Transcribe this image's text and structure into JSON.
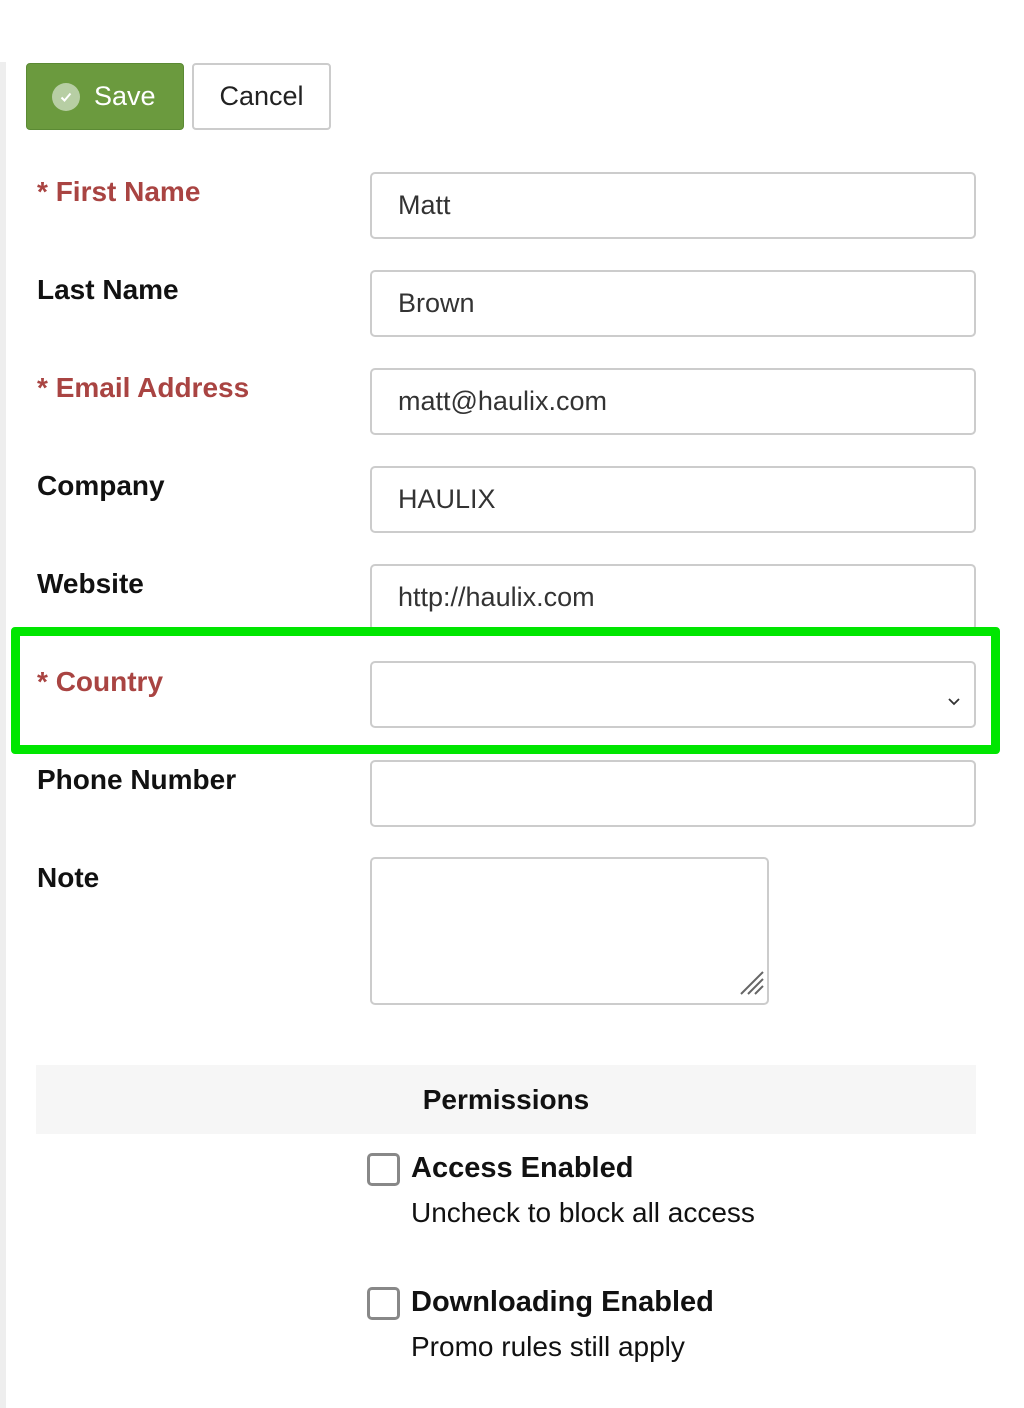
{
  "toolbar": {
    "save_label": "Save",
    "cancel_label": "Cancel",
    "save_icon": "check-circle-icon"
  },
  "form": {
    "first_name": {
      "asterisk": "*",
      "label": "First Name",
      "value": "Matt",
      "required": true
    },
    "last_name": {
      "label": "Last Name",
      "value": "Brown"
    },
    "email": {
      "asterisk": "*",
      "label": "Email Address",
      "value": "matt@haulix.com",
      "required": true
    },
    "company": {
      "label": "Company",
      "value": "HAULIX"
    },
    "website": {
      "label": "Website",
      "value": "http://haulix.com"
    },
    "country": {
      "asterisk": "*",
      "label": "Country",
      "value": "",
      "required": true,
      "icon": "chevron-down-icon"
    },
    "phone": {
      "label": "Phone Number",
      "value": ""
    },
    "note": {
      "label": "Note",
      "value": ""
    }
  },
  "permissions": {
    "heading": "Permissions",
    "access": {
      "title": "Access Enabled",
      "help": "Uncheck to block all access",
      "checked": false
    },
    "downloading": {
      "title": "Downloading Enabled",
      "help": "Promo rules still apply",
      "checked": false
    }
  },
  "colors": {
    "required_label": "#a94442",
    "save_button": "#6b9a3e",
    "highlight": "#00e600"
  }
}
